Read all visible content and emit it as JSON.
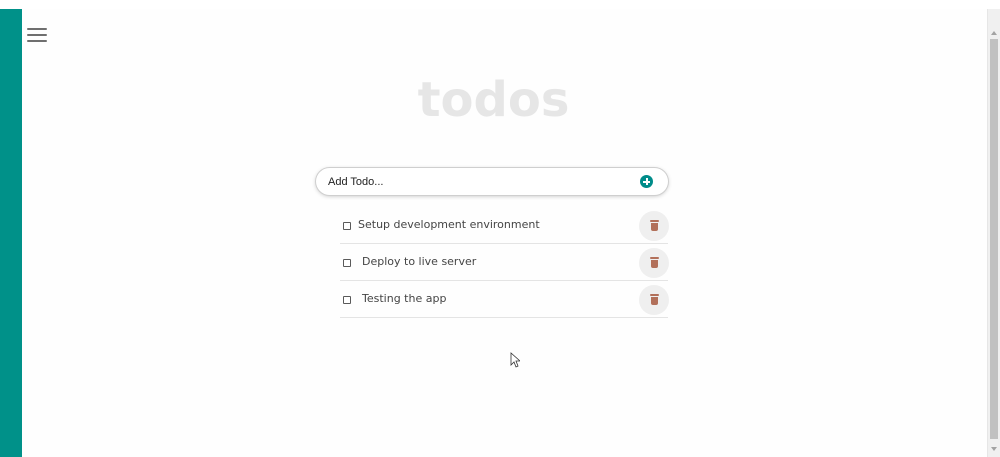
{
  "app": {
    "title": "todos"
  },
  "add_todo": {
    "placeholder": "Add Todo...",
    "add_icon": "plus-circle-icon",
    "accent_color": "#008c8a"
  },
  "todos": [
    {
      "text": "Setup development environment",
      "completed": false,
      "delete_icon": "trash-icon"
    },
    {
      "text": "Deploy to live server",
      "completed": false,
      "delete_icon": "trash-icon"
    },
    {
      "text": "Testing the app",
      "completed": false,
      "delete_icon": "trash-icon"
    }
  ],
  "theme": {
    "sidebar_color": "#009189",
    "trash_color": "#b2705a",
    "title_color": "#e6e6e6"
  },
  "icons": {
    "menu": "hamburger-menu-icon"
  }
}
